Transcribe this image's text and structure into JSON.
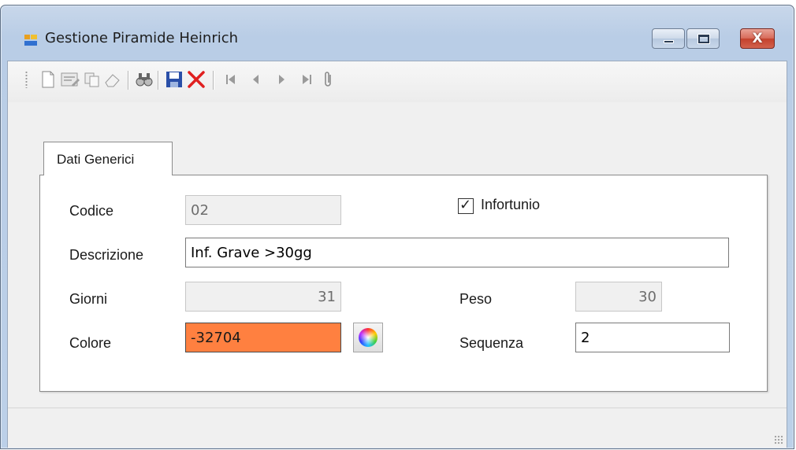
{
  "window": {
    "title": "Gestione Piramide Heinrich",
    "icon": "app-window-icon",
    "controls": {
      "minimize": "minimize-icon",
      "maximize": "maximize-icon",
      "close": "close-icon",
      "close_glyph": "X"
    }
  },
  "toolbar": {
    "buttons": [
      {
        "name": "new-icon"
      },
      {
        "name": "edit-icon"
      },
      {
        "name": "copy-icon"
      },
      {
        "name": "erase-icon"
      },
      {
        "name": "find-icon"
      },
      {
        "name": "save-icon"
      },
      {
        "name": "delete-icon"
      },
      {
        "name": "first-record-icon"
      },
      {
        "name": "previous-record-icon"
      },
      {
        "name": "next-record-icon"
      },
      {
        "name": "last-record-icon"
      },
      {
        "name": "attachment-icon"
      }
    ]
  },
  "tabs": [
    {
      "label": "Dati Generici",
      "active": true
    }
  ],
  "form": {
    "codice": {
      "label": "Codice",
      "value": "02"
    },
    "infortunio": {
      "label": "Infortunio",
      "checked": true
    },
    "descrizione": {
      "label": "Descrizione",
      "value": "Inf. Grave >30gg"
    },
    "giorni": {
      "label": "Giorni",
      "value": "31"
    },
    "peso": {
      "label": "Peso",
      "value": "30"
    },
    "colore": {
      "label": "Colore",
      "value": "-32704",
      "swatch": "#ff8040"
    },
    "sequenza": {
      "label": "Sequenza",
      "value": "2"
    }
  },
  "colors": {
    "accent_close": "#c4412c",
    "save_blue": "#2a4fa8",
    "delete_red": "#e02020"
  }
}
